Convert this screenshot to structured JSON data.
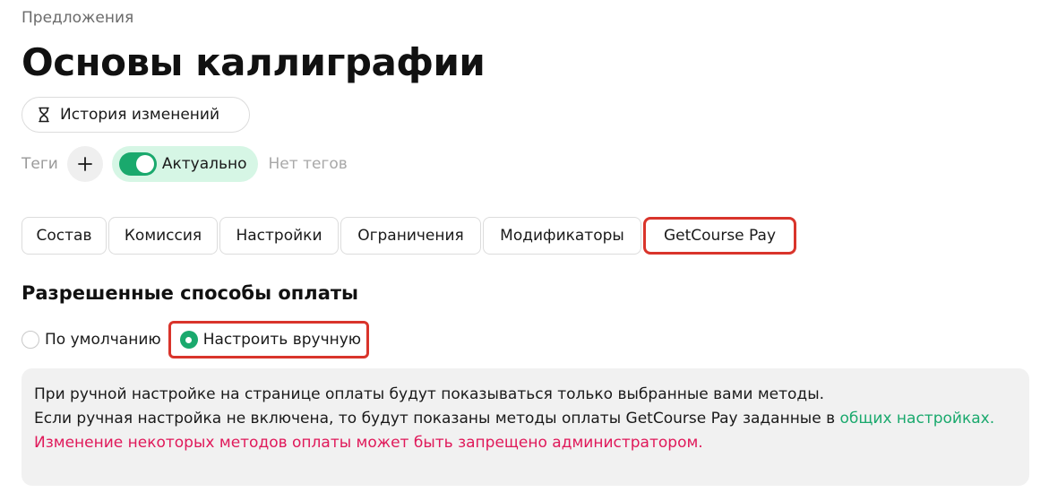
{
  "breadcrumb": "Предложения",
  "title": "Основы каллиграфии",
  "history_button": "История изменений",
  "tags": {
    "label": "Теги",
    "status_label": "Актуально",
    "status_on": true,
    "empty_text": "Нет тегов"
  },
  "tabs": [
    {
      "label": "Состав"
    },
    {
      "label": "Комиссия"
    },
    {
      "label": "Настройки"
    },
    {
      "label": "Ограничения"
    },
    {
      "label": "Модификаторы"
    },
    {
      "label": "GetCourse Pay",
      "active": true
    }
  ],
  "payment": {
    "section_title": "Разрешенные способы оплаты",
    "options": [
      {
        "label": "По умолчанию",
        "selected": false
      },
      {
        "label": "Настроить вручную",
        "selected": true
      }
    ]
  },
  "info": {
    "line1": "При ручной настройке на странице оплаты будут показываться только выбранные вами методы.",
    "line2_prefix": "Если ручная настройка не включена, то будут показаны методы оплаты GetCourse Pay заданные в ",
    "link_text": "общих настройках.",
    "warning": "Изменение некоторых методов оплаты может быть запрещено администратором."
  },
  "colors": {
    "accent_green": "#1aa96d",
    "highlight_red": "#d9342b",
    "warning_pink": "#e0195a"
  },
  "icons": {
    "history": "hourglass-icon",
    "add_tag": "plus-icon"
  }
}
